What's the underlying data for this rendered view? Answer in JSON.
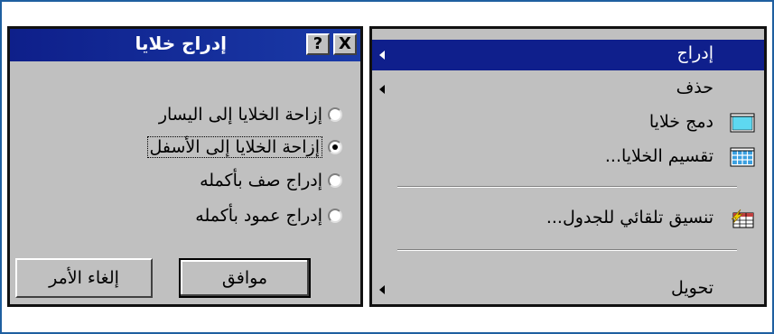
{
  "dialog": {
    "title": "إدراج خلايا",
    "close_label": "X",
    "help_label": "?",
    "options": [
      {
        "label": "إزاحة الخلايا إلى اليسار",
        "checked": false
      },
      {
        "label": "إزاحة الخلايا إلى الأسفل",
        "checked": true
      },
      {
        "label": "إدراج صف بأكمله",
        "checked": false
      },
      {
        "label": "إدراج عمود بأكمله",
        "checked": false
      }
    ],
    "ok_label": "موافق",
    "cancel_label": "إلغاء الأمر"
  },
  "menu": {
    "items": [
      {
        "label": "إدراج",
        "icon": null,
        "submenu": true,
        "selected": true
      },
      {
        "label": "حذف",
        "icon": null,
        "submenu": true,
        "selected": false
      },
      {
        "label": "دمج خلايا",
        "icon": "merge-cells-icon",
        "submenu": false,
        "selected": false
      },
      {
        "label": "تقسيم الخلايا...",
        "icon": "split-cells-icon",
        "submenu": false,
        "selected": false
      },
      {
        "label": "تنسيق تلقائي للجدول...",
        "icon": "table-autoformat-icon",
        "submenu": false,
        "selected": false
      },
      {
        "label": "تحويل",
        "icon": null,
        "submenu": true,
        "selected": false
      }
    ]
  },
  "colors": {
    "titlebar": "#0e1f8a",
    "selection": "#0f1f8c",
    "face": "#c0c0c0",
    "frame": "#1f5fa0"
  }
}
